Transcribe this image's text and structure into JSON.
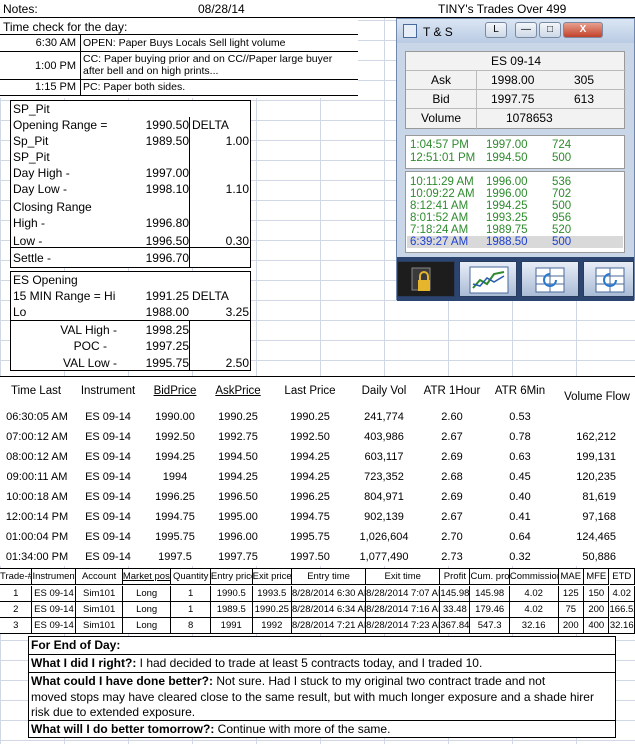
{
  "header": {
    "notes_label": "Notes:",
    "date": "08/28/14",
    "title": "TINY's Trades Over 499"
  },
  "timeline": {
    "label": "Time check for the day:",
    "entries": [
      {
        "time": "6:30 AM",
        "note": "OPEN: Paper Buys Locals Sell light volume"
      },
      {
        "time": "1:00 PM",
        "note": "CC: Paper buying prior and on CC//Paper large buyer",
        "note2": "after bell and on high prints..."
      },
      {
        "time": "1:15 PM",
        "note": "PC: Paper both sides."
      }
    ]
  },
  "sp_pit": {
    "title": "SP_Pit",
    "opening_range_label": "Opening Range =",
    "opening_range_value": "1990.50",
    "delta_label": "DELTA",
    "sp_pit_label": "Sp_Pit",
    "sp_pit_value": "1989.50",
    "sp_pit_delta": "1.00",
    "title2": "SP_Pit",
    "day_high_label": "Day High -",
    "day_high_value": "1997.00",
    "day_low_label": "Day Low -",
    "day_low_value": "1998.10",
    "day_low_delta": "1.10",
    "closing_range_label": "Closing Range",
    "high_label": "High -",
    "high_value": "1996.80",
    "low_label": "Low -",
    "low_value": "1996.50",
    "low_delta": "0.30",
    "settle_label": "Settle -",
    "settle_value": "1996.70"
  },
  "es_opening": {
    "title": "ES Opening",
    "range_label": "15 MIN Range = Hi",
    "range_hi": "1991.25",
    "delta_label": "DELTA",
    "lo_label": "Lo",
    "lo_value": "1988.00",
    "lo_delta": "3.25",
    "val_high_label": "VAL High  -",
    "val_high_value": "1998.25",
    "poc_label": "POC  -",
    "poc_value": "1997.25",
    "val_low_label": "VAL Low  -",
    "val_low_value": "1995.75",
    "val_low_delta": "2.50"
  },
  "ts_window": {
    "title": "T & S",
    "instrument": "ES 09-14",
    "ask_label": "Ask",
    "ask_price": "1998.00",
    "ask_size": "305",
    "bid_label": "Bid",
    "bid_price": "1997.75",
    "bid_size": "613",
    "volume_label": "Volume",
    "volume": "1078653",
    "tape_top": [
      {
        "time": "1:04:57 PM",
        "price": "1997.00",
        "size": "724"
      },
      {
        "time": "12:51:01 PM",
        "price": "1994.50",
        "size": "500"
      }
    ],
    "tape_bottom": [
      {
        "time": "10:11:29 AM",
        "price": "1996.00",
        "size": "536"
      },
      {
        "time": "10:09:22 AM",
        "price": "1996.00",
        "size": "702"
      },
      {
        "time": "8:12:41 AM",
        "price": "1994.25",
        "size": "500"
      },
      {
        "time": "8:01:52 AM",
        "price": "1993.25",
        "size": "956"
      },
      {
        "time": "7:18:24 AM",
        "price": "1989.75",
        "size": "520"
      },
      {
        "time": "6:39:27 AM",
        "price": "1988.50",
        "size": "500"
      }
    ],
    "colors": {
      "tape": "#2e8b2e",
      "selected_text": "#1e3fd0",
      "selected_bg": "#d9d9d9"
    }
  },
  "market": {
    "headers": [
      "Time Last",
      "Instrument",
      "BidPrice",
      "AskPrice",
      "Last Price",
      "Daily Vol",
      "ATR 1Hour",
      "ATR 6Min",
      "Volume Flow"
    ],
    "rows": [
      [
        "06:30:05 AM",
        "ES 09-14",
        "1990.00",
        "1990.25",
        "1990.25",
        "241,774",
        "2.60",
        "0.53",
        ""
      ],
      [
        "07:00:12 AM",
        "ES 09-14",
        "1992.50",
        "1992.75",
        "1992.50",
        "403,986",
        "2.67",
        "0.78",
        "162,212"
      ],
      [
        "08:00:12 AM",
        "ES 09-14",
        "1994.25",
        "1994.50",
        "1994.25",
        "603,117",
        "2.69",
        "0.63",
        "199,131"
      ],
      [
        "09:00:11 AM",
        "ES 09-14",
        "1994",
        "1994.25",
        "1994.25",
        "723,352",
        "2.68",
        "0.45",
        "120,235"
      ],
      [
        "10:00:18 AM",
        "ES 09-14",
        "1996.25",
        "1996.50",
        "1996.25",
        "804,971",
        "2.69",
        "0.40",
        "81,619"
      ],
      [
        "12:00:14 PM",
        "ES 09-14",
        "1994.75",
        "1995.00",
        "1994.75",
        "902,139",
        "2.67",
        "0.41",
        "97,168"
      ],
      [
        "01:00:04 PM",
        "ES 09-14",
        "1995.75",
        "1996.00",
        "1995.75",
        "1,026,604",
        "2.70",
        "0.64",
        "124,465"
      ],
      [
        "01:34:00 PM",
        "ES 09-14",
        "1997.5",
        "1997.75",
        "1997.50",
        "1,077,490",
        "2.73",
        "0.32",
        "50,886"
      ]
    ]
  },
  "trades": {
    "headers": [
      "Trade-#",
      "Instrument",
      "Account",
      "Market pos.",
      "Quantity",
      "Entry price",
      "Exit price",
      "Entry time",
      "Exit time",
      "Profit",
      "Cum. profit",
      "Commission",
      "MAE",
      "MFE",
      "ETD"
    ],
    "rows": [
      [
        "1",
        "ES 09-14",
        "Sim101",
        "Long",
        "1",
        "1990.5",
        "1993.5",
        "8/28/2014 6:30 AM",
        "8/28/2014 7:07 AM",
        "145.98",
        "145.98",
        "4.02",
        "125",
        "150",
        "4.02"
      ],
      [
        "2",
        "ES 09-14",
        "Sim101",
        "Long",
        "1",
        "1989.5",
        "1990.25",
        "8/28/2014 6:34 AM",
        "8/28/2014 7:16 AM",
        "33.48",
        "179.46",
        "4.02",
        "75",
        "200",
        "166.52"
      ],
      [
        "3",
        "ES 09-14",
        "Sim101",
        "Long",
        "8",
        "1991",
        "1992",
        "8/28/2014 7:21 AM",
        "8/28/2014 7:23 AM",
        "367.84",
        "547.3",
        "32.16",
        "200",
        "400",
        "32.16"
      ]
    ]
  },
  "end_of_day": {
    "title": "For End of Day:",
    "q1": "What I did I right?:",
    "a1": " I had decided to trade at least 5 contracts today, and I traded 10.",
    "q2": "What could I have done better?:",
    "a2": " Not sure.  Had I stuck to my original two contract trade and not",
    "a2b": "moved stops may have cleared close to the same result, but with much longer exposure and a shade hirer",
    "a2c": "risk due to extended exposure.",
    "q3": "What will I do better tomorrow?:",
    "a3": "  Continue with more of the same."
  }
}
